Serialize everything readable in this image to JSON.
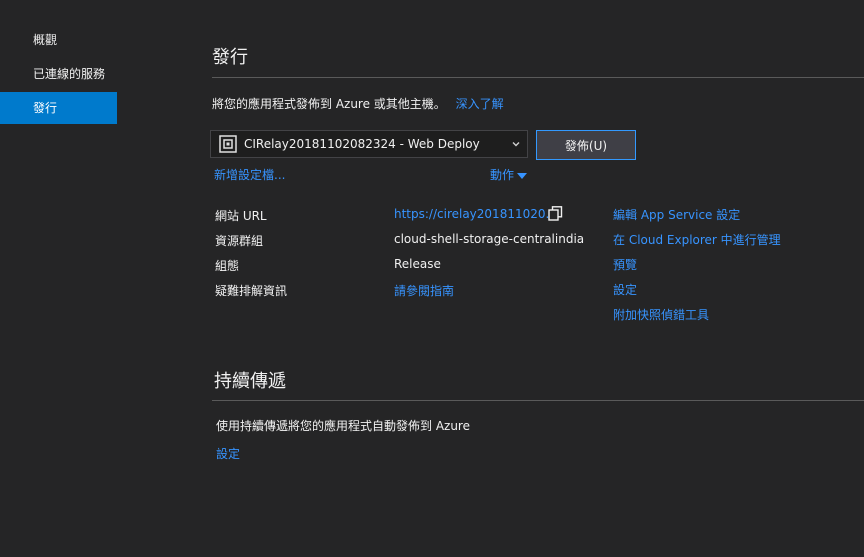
{
  "sidebar": {
    "items": [
      {
        "label": "概觀"
      },
      {
        "label": "已連線的服務"
      },
      {
        "label": "發行"
      }
    ]
  },
  "publish": {
    "title": "發行",
    "description": "將您的應用程式發佈到 Azure 或其他主機。",
    "learn_more": "深入了解",
    "profile_value": "CIRelay20181102082324 - Web Deploy",
    "publish_button": "發佈(U)",
    "new_profile": "新增設定檔...",
    "actions": "動作",
    "info_labels": {
      "site_url": "網站 URL",
      "resource_group": "資源群組",
      "configuration": "組態",
      "troubleshooting": "疑難排解資訊"
    },
    "info_values": {
      "site_url": "https://cirelay201811020...",
      "resource_group": "cloud-shell-storage-centralindia",
      "configuration": "Release",
      "troubleshooting": "請參閱指南"
    },
    "right_links": {
      "edit_app_service": "編輯 App Service 設定",
      "cloud_explorer": "在 Cloud Explorer 中進行管理",
      "preview": "預覽",
      "settings": "設定",
      "attach_debugger": "附加快照偵錯工具"
    }
  },
  "continuous": {
    "title": "持續傳遞",
    "description": "使用持續傳遞將您的應用程式自動發佈到 Azure",
    "settings_link": "設定"
  },
  "colors": {
    "background": "#252526",
    "accent": "#007acc",
    "link": "#3794ff",
    "button_border": "#3399ff"
  },
  "icons": {
    "profile": "publish-profile-icon",
    "dropdown": "chevron-down-icon",
    "actions": "caret-down-icon",
    "copy": "copy-icon"
  }
}
